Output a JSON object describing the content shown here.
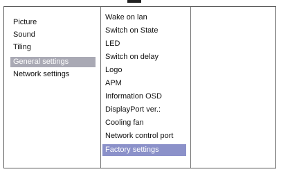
{
  "main_menu": {
    "items": [
      {
        "label": "Picture"
      },
      {
        "label": "Sound"
      },
      {
        "label": "Tiling"
      },
      {
        "label": "General settings"
      },
      {
        "label": "Network settings"
      }
    ],
    "selected_label": "General settings"
  },
  "sub_menu": {
    "items": [
      {
        "label": "Wake on lan"
      },
      {
        "label": "Switch on State"
      },
      {
        "label": "LED"
      },
      {
        "label": "Switch on delay"
      },
      {
        "label": "Logo"
      },
      {
        "label": "APM"
      },
      {
        "label": "Information OSD"
      },
      {
        "label": "DisplayPort ver.:"
      },
      {
        "label": "Cooling fan"
      },
      {
        "label": "Network control port"
      },
      {
        "label": "Factory settings"
      }
    ],
    "highlighted_label": "Factory settings"
  },
  "colors": {
    "main_selected_bg": "#a9a9b4",
    "sub_highlight_bg": "#8b91c9",
    "frame": "#555555"
  }
}
